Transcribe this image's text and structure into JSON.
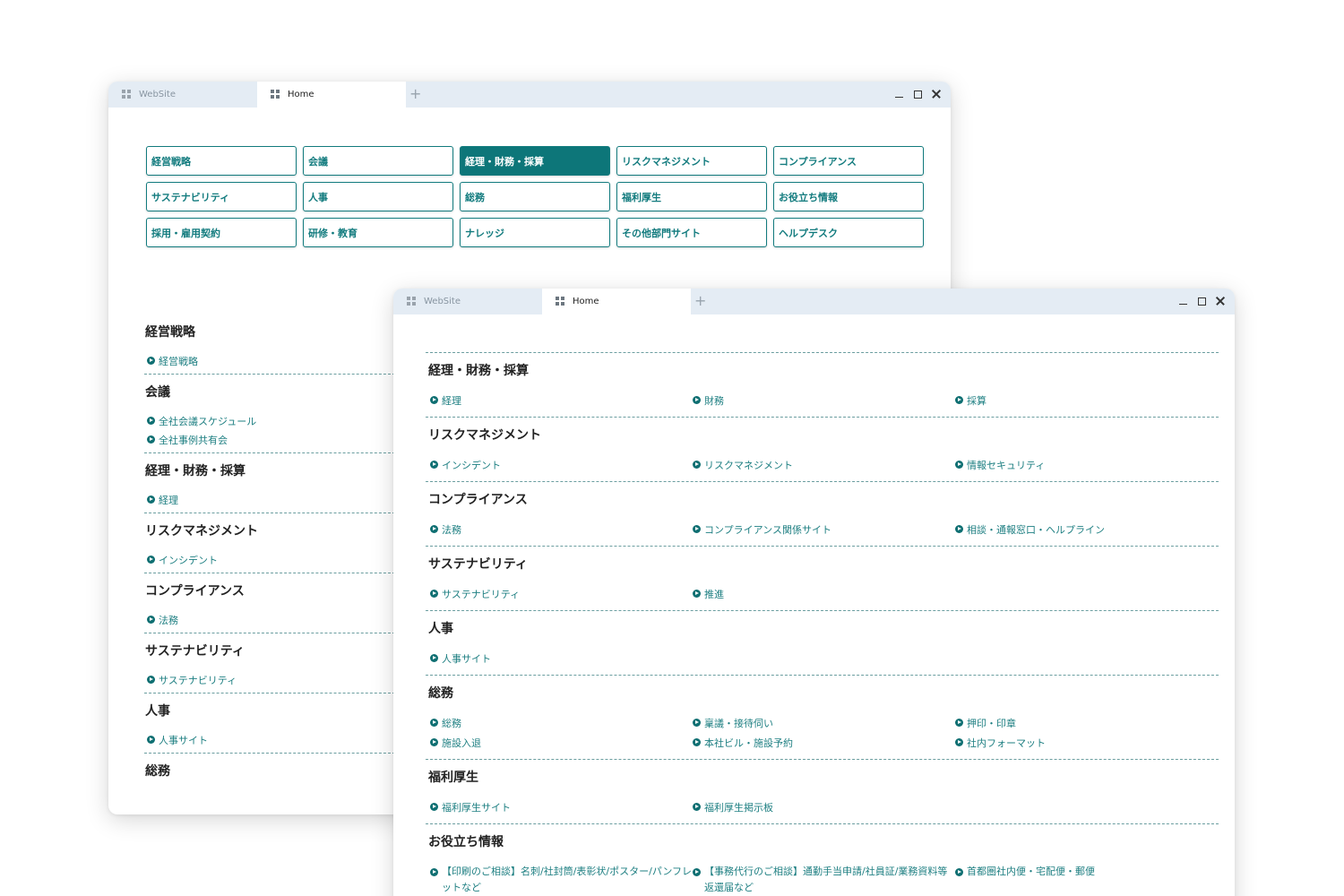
{
  "back_window": {
    "tabs": [
      {
        "label": "WebSite"
      },
      {
        "label": "Home"
      }
    ],
    "nav_buttons": [
      {
        "label": "経営戦略"
      },
      {
        "label": "会議"
      },
      {
        "label": "経理・財務・採算"
      },
      {
        "label": "リスクマネジメント"
      },
      {
        "label": "コンプライアンス"
      },
      {
        "label": "サステナビリティ"
      },
      {
        "label": "人事"
      },
      {
        "label": "総務"
      },
      {
        "label": "福利厚生"
      },
      {
        "label": "お役立ち情報"
      },
      {
        "label": "採用・雇用契約"
      },
      {
        "label": "研修・教育"
      },
      {
        "label": "ナレッジ"
      },
      {
        "label": "その他部門サイト"
      },
      {
        "label": "ヘルプデスク"
      }
    ],
    "active_nav": "経理・財務・採算",
    "sections": [
      {
        "title": "経営戦略",
        "links": [
          "経営戦略"
        ]
      },
      {
        "title": "会議",
        "links": [
          "全社会議スケジュール",
          "全社事例共有会"
        ]
      },
      {
        "title": "経理・財務・採算",
        "links": [
          "経理"
        ]
      },
      {
        "title": "リスクマネジメント",
        "links": [
          "インシデント"
        ]
      },
      {
        "title": "コンプライアンス",
        "links": [
          "法務"
        ]
      },
      {
        "title": "サステナビリティ",
        "links": [
          "サステナビリティ"
        ]
      },
      {
        "title": "人事",
        "links": [
          "人事サイト"
        ]
      },
      {
        "title": "総務",
        "links": []
      }
    ]
  },
  "front_window": {
    "tabs": [
      {
        "label": "WebSite"
      },
      {
        "label": "Home"
      }
    ],
    "sections": [
      {
        "title": "経理・財務・採算",
        "links": [
          "経理",
          "財務",
          "採算"
        ]
      },
      {
        "title": "リスクマネジメント",
        "links": [
          "インシデント",
          "リスクマネジメント",
          "情報セキュリティ"
        ]
      },
      {
        "title": "コンプライアンス",
        "links": [
          "法務",
          "コンプライアンス関係サイト",
          "相談・通報窓口・ヘルプライン"
        ]
      },
      {
        "title": "サステナビリティ",
        "links": [
          "サステナビリティ",
          "推進"
        ]
      },
      {
        "title": "人事",
        "links": [
          "人事サイト"
        ]
      },
      {
        "title": "総務",
        "links": [
          "総務",
          "稟議・接待伺い",
          "押印・印章",
          "施設入退",
          "本社ビル・施設予約",
          "社内フォーマット"
        ]
      },
      {
        "title": "福利厚生",
        "links": [
          "福利厚生サイト",
          "福利厚生掲示板"
        ]
      },
      {
        "title": "お役立ち情報",
        "links": [
          "【印刷のご相談】名刺/社封筒/表彰状/ポスター/パンフレットなど",
          "【事務代行のご相談】通勤手当申請/社員証/業務資料等返還届など",
          "首都圏社内便・宅配便・郵便"
        ]
      }
    ]
  },
  "colors": {
    "accent": "#127b7e",
    "active_button_bg": "#0d7679",
    "titlebar_bg": "#e4ecf4",
    "link_text": "#1e7f82"
  }
}
